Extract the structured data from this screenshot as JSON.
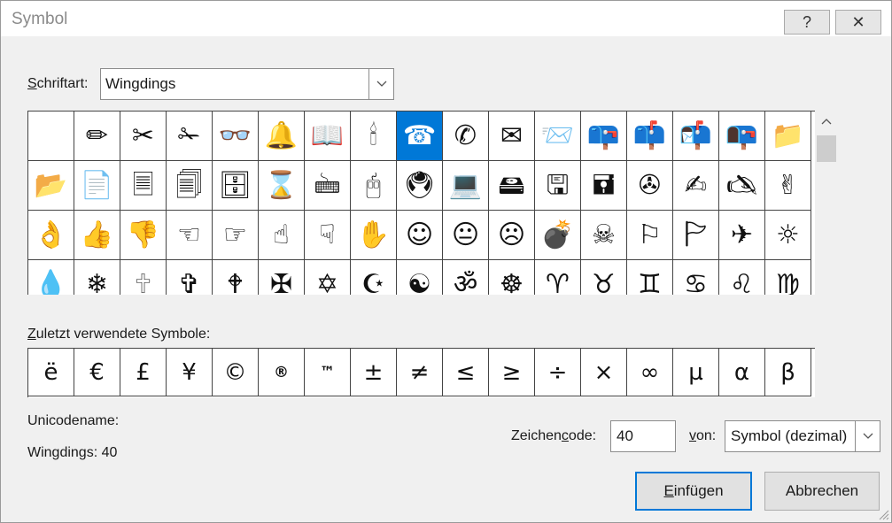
{
  "window": {
    "title": "Symbol",
    "help_glyph": "?",
    "close_glyph": "✕"
  },
  "font": {
    "label_accel": "S",
    "label_rest": "chriftart:",
    "value": "Wingdings"
  },
  "grid": {
    "rows": [
      [
        " ",
        "✏",
        "✂",
        "✁",
        "👓",
        "🔔",
        "📖",
        "🕯",
        "☎",
        "✆",
        "✉",
        "📨",
        "📪",
        "📫",
        "📬",
        "📭",
        "📁"
      ],
      [
        "📂",
        "📄",
        "🗏",
        "🗐",
        "🗄",
        "⌛",
        "🖮",
        "🖰",
        "🖲",
        "💻",
        "🖴",
        "🖫",
        "🖬",
        "✇",
        "✍",
        "🖎",
        "✌"
      ],
      [
        "👌",
        "👍",
        "👎",
        "☜",
        "☞",
        "☝",
        "☟",
        "✋",
        "☺",
        "😐",
        "☹",
        "💣",
        "☠",
        "⚐",
        "🏱",
        "✈",
        "☼"
      ],
      [
        "💧",
        "❄",
        "🕆",
        "✞",
        "🕈",
        "✠",
        "✡",
        "☪",
        "☯",
        "ॐ",
        "☸",
        "♈",
        "♉",
        "♊",
        "♋",
        "♌",
        "♍"
      ]
    ],
    "selected_index": 8
  },
  "recent": {
    "label_accel": "Z",
    "label_rest": "uletzt verwendete Symbole:",
    "symbols": [
      "ë",
      "€",
      "£",
      "¥",
      "©",
      "®",
      "™",
      "±",
      "≠",
      "≤",
      "≥",
      "÷",
      "×",
      "∞",
      "µ",
      "α",
      "β"
    ]
  },
  "unicode_label": "Unicodename:",
  "char_name": "Wingdings: 40",
  "code": {
    "label_pre": "Zeichen",
    "label_accel": "c",
    "label_post": "ode:",
    "value": "40"
  },
  "from": {
    "label_accel": "v",
    "label_rest": "on:",
    "value": "Symbol (dezimal)"
  },
  "buttons": {
    "insert_accel": "E",
    "insert_rest": "infügen",
    "cancel": "Abbrechen"
  },
  "colors": {
    "selection": "#0078d7",
    "default_button_border": "#0078d7"
  }
}
